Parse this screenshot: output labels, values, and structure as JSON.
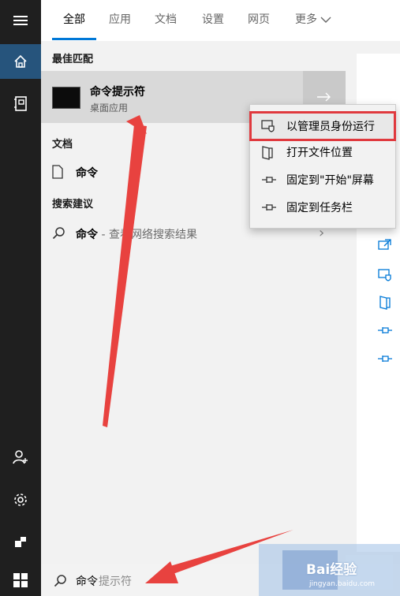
{
  "tabs": {
    "all": "全部",
    "apps": "应用",
    "docs": "文档",
    "settings": "设置",
    "web": "网页",
    "more": "更多"
  },
  "sections": {
    "best_match": "最佳匹配",
    "documents": "文档",
    "suggestions": "搜索建议"
  },
  "best_match": {
    "title": "命令提示符",
    "subtitle": "桌面应用",
    "icon": "cmd-icon"
  },
  "document_item": {
    "label": "命令",
    "icon": "document-icon"
  },
  "suggestion_item": {
    "label": "命令",
    "suffix": " - 查看网络搜索结果",
    "icon": "search-icon"
  },
  "context_menu": [
    {
      "label": "以管理员身份运行",
      "icon": "shield-admin-icon",
      "highlighted": true
    },
    {
      "label": "打开文件位置",
      "icon": "file-location-icon"
    },
    {
      "label": "固定到\"开始\"屏幕",
      "icon": "pin-icon"
    },
    {
      "label": "固定到任务栏",
      "icon": "pin-icon"
    }
  ],
  "rail_icons": [
    "hamburger-icon",
    "home-icon",
    "notebook-icon",
    "person-add-icon",
    "gear-icon",
    "feedback-icon"
  ],
  "search": {
    "typed": "命令",
    "hint": "提示符"
  },
  "watermark": {
    "text": "Bai经验",
    "sub": "jingyan.baidu.com"
  },
  "colors": {
    "accent": "#0078d7",
    "highlight_border": "#e0393e",
    "annotation_arrow": "#e8423f",
    "rail_bg": "#1f1f1f",
    "rail_home_bg": "#26547c"
  }
}
